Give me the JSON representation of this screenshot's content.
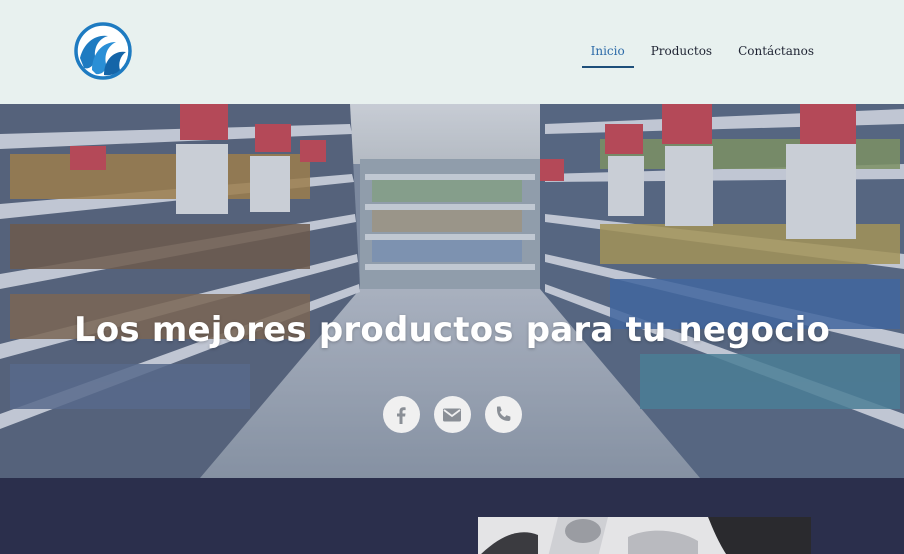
{
  "brand": {
    "logo_icon": "wave-logo-icon",
    "accent": "#1e7bc1"
  },
  "nav": {
    "items": [
      {
        "label": "Inicio",
        "active": true
      },
      {
        "label": "Productos",
        "active": false
      },
      {
        "label": "Contáctanos",
        "active": false
      }
    ]
  },
  "hero": {
    "title": "Los mejores productos para tu negocio",
    "image": "supermarket-aisle-photo"
  },
  "socials": [
    {
      "icon": "facebook-icon"
    },
    {
      "icon": "email-icon"
    },
    {
      "icon": "phone-icon"
    }
  ],
  "colors": {
    "header_bg": "#e8f1ef",
    "band_bg": "#2b2f4c",
    "nav_active": "#2c6aa8"
  }
}
